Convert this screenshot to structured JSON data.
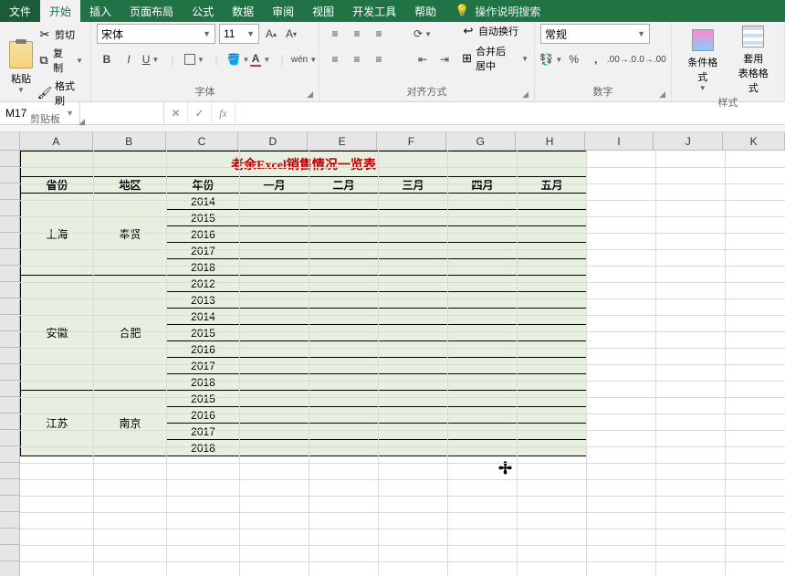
{
  "tabs": {
    "file": "文件",
    "home": "开始",
    "insert": "插入",
    "layout": "页面布局",
    "formulas": "公式",
    "data": "数据",
    "review": "审阅",
    "view": "视图",
    "dev": "开发工具",
    "help": "帮助",
    "search": "操作说明搜索"
  },
  "clipboard": {
    "paste": "粘贴",
    "cut": "剪切",
    "copy": "复制",
    "format_painter": "格式刷",
    "group": "剪贴板"
  },
  "font": {
    "name": "宋体",
    "size": "11",
    "group": "字体",
    "wen": "wén"
  },
  "align": {
    "group": "对齐方式",
    "wrap": "自动换行",
    "merge": "合并后居中"
  },
  "number": {
    "group": "数字",
    "format": "常规"
  },
  "styles": {
    "group": "样式",
    "cond": "条件格式",
    "table": "套用",
    "table2": "表格格式"
  },
  "namebox": "M17",
  "formula": "",
  "columns": [
    "A",
    "B",
    "C",
    "D",
    "E",
    "F",
    "G",
    "H",
    "I",
    "J",
    "K"
  ],
  "sheet": {
    "title": "老余Excel销售情况一览表",
    "headers": [
      "省份",
      "地区",
      "年份",
      "一月",
      "二月",
      "三月",
      "四月",
      "五月"
    ],
    "groups": [
      {
        "province": "上海",
        "region": "奉贤",
        "years": [
          "2014",
          "2015",
          "2016",
          "2017",
          "2018"
        ]
      },
      {
        "province": "安徽",
        "region": "合肥",
        "years": [
          "2012",
          "2013",
          "2014",
          "2015",
          "2016",
          "2017",
          "2018"
        ]
      },
      {
        "province": "江苏",
        "region": "南京",
        "years": [
          "2015",
          "2016",
          "2017",
          "2018"
        ]
      }
    ]
  }
}
